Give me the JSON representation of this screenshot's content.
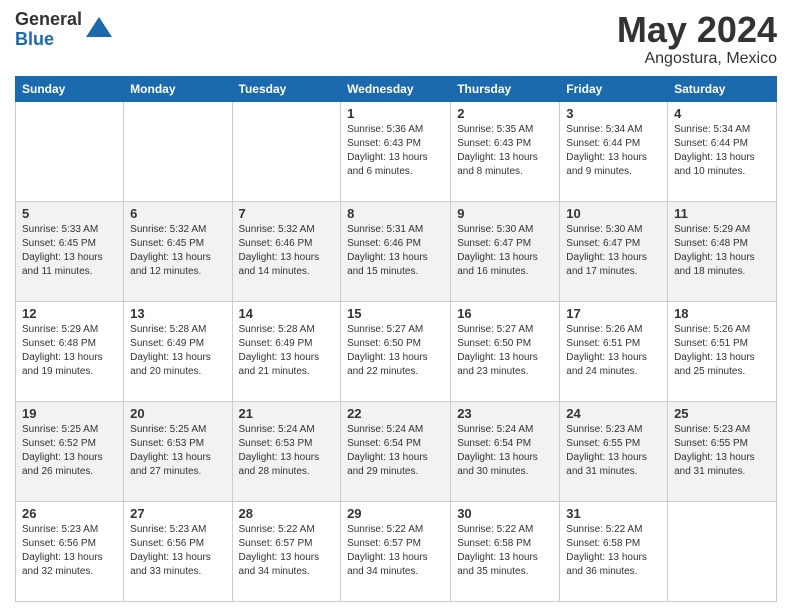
{
  "logo": {
    "general": "General",
    "blue": "Blue"
  },
  "title": {
    "month": "May 2024",
    "location": "Angostura, Mexico"
  },
  "calendar": {
    "headers": [
      "Sunday",
      "Monday",
      "Tuesday",
      "Wednesday",
      "Thursday",
      "Friday",
      "Saturday"
    ],
    "weeks": [
      [
        {
          "day": "",
          "info": ""
        },
        {
          "day": "",
          "info": ""
        },
        {
          "day": "",
          "info": ""
        },
        {
          "day": "1",
          "info": "Sunrise: 5:36 AM\nSunset: 6:43 PM\nDaylight: 13 hours\nand 6 minutes."
        },
        {
          "day": "2",
          "info": "Sunrise: 5:35 AM\nSunset: 6:43 PM\nDaylight: 13 hours\nand 8 minutes."
        },
        {
          "day": "3",
          "info": "Sunrise: 5:34 AM\nSunset: 6:44 PM\nDaylight: 13 hours\nand 9 minutes."
        },
        {
          "day": "4",
          "info": "Sunrise: 5:34 AM\nSunset: 6:44 PM\nDaylight: 13 hours\nand 10 minutes."
        }
      ],
      [
        {
          "day": "5",
          "info": "Sunrise: 5:33 AM\nSunset: 6:45 PM\nDaylight: 13 hours\nand 11 minutes."
        },
        {
          "day": "6",
          "info": "Sunrise: 5:32 AM\nSunset: 6:45 PM\nDaylight: 13 hours\nand 12 minutes."
        },
        {
          "day": "7",
          "info": "Sunrise: 5:32 AM\nSunset: 6:46 PM\nDaylight: 13 hours\nand 14 minutes."
        },
        {
          "day": "8",
          "info": "Sunrise: 5:31 AM\nSunset: 6:46 PM\nDaylight: 13 hours\nand 15 minutes."
        },
        {
          "day": "9",
          "info": "Sunrise: 5:30 AM\nSunset: 6:47 PM\nDaylight: 13 hours\nand 16 minutes."
        },
        {
          "day": "10",
          "info": "Sunrise: 5:30 AM\nSunset: 6:47 PM\nDaylight: 13 hours\nand 17 minutes."
        },
        {
          "day": "11",
          "info": "Sunrise: 5:29 AM\nSunset: 6:48 PM\nDaylight: 13 hours\nand 18 minutes."
        }
      ],
      [
        {
          "day": "12",
          "info": "Sunrise: 5:29 AM\nSunset: 6:48 PM\nDaylight: 13 hours\nand 19 minutes."
        },
        {
          "day": "13",
          "info": "Sunrise: 5:28 AM\nSunset: 6:49 PM\nDaylight: 13 hours\nand 20 minutes."
        },
        {
          "day": "14",
          "info": "Sunrise: 5:28 AM\nSunset: 6:49 PM\nDaylight: 13 hours\nand 21 minutes."
        },
        {
          "day": "15",
          "info": "Sunrise: 5:27 AM\nSunset: 6:50 PM\nDaylight: 13 hours\nand 22 minutes."
        },
        {
          "day": "16",
          "info": "Sunrise: 5:27 AM\nSunset: 6:50 PM\nDaylight: 13 hours\nand 23 minutes."
        },
        {
          "day": "17",
          "info": "Sunrise: 5:26 AM\nSunset: 6:51 PM\nDaylight: 13 hours\nand 24 minutes."
        },
        {
          "day": "18",
          "info": "Sunrise: 5:26 AM\nSunset: 6:51 PM\nDaylight: 13 hours\nand 25 minutes."
        }
      ],
      [
        {
          "day": "19",
          "info": "Sunrise: 5:25 AM\nSunset: 6:52 PM\nDaylight: 13 hours\nand 26 minutes."
        },
        {
          "day": "20",
          "info": "Sunrise: 5:25 AM\nSunset: 6:53 PM\nDaylight: 13 hours\nand 27 minutes."
        },
        {
          "day": "21",
          "info": "Sunrise: 5:24 AM\nSunset: 6:53 PM\nDaylight: 13 hours\nand 28 minutes."
        },
        {
          "day": "22",
          "info": "Sunrise: 5:24 AM\nSunset: 6:54 PM\nDaylight: 13 hours\nand 29 minutes."
        },
        {
          "day": "23",
          "info": "Sunrise: 5:24 AM\nSunset: 6:54 PM\nDaylight: 13 hours\nand 30 minutes."
        },
        {
          "day": "24",
          "info": "Sunrise: 5:23 AM\nSunset: 6:55 PM\nDaylight: 13 hours\nand 31 minutes."
        },
        {
          "day": "25",
          "info": "Sunrise: 5:23 AM\nSunset: 6:55 PM\nDaylight: 13 hours\nand 31 minutes."
        }
      ],
      [
        {
          "day": "26",
          "info": "Sunrise: 5:23 AM\nSunset: 6:56 PM\nDaylight: 13 hours\nand 32 minutes."
        },
        {
          "day": "27",
          "info": "Sunrise: 5:23 AM\nSunset: 6:56 PM\nDaylight: 13 hours\nand 33 minutes."
        },
        {
          "day": "28",
          "info": "Sunrise: 5:22 AM\nSunset: 6:57 PM\nDaylight: 13 hours\nand 34 minutes."
        },
        {
          "day": "29",
          "info": "Sunrise: 5:22 AM\nSunset: 6:57 PM\nDaylight: 13 hours\nand 34 minutes."
        },
        {
          "day": "30",
          "info": "Sunrise: 5:22 AM\nSunset: 6:58 PM\nDaylight: 13 hours\nand 35 minutes."
        },
        {
          "day": "31",
          "info": "Sunrise: 5:22 AM\nSunset: 6:58 PM\nDaylight: 13 hours\nand 36 minutes."
        },
        {
          "day": "",
          "info": ""
        }
      ]
    ]
  }
}
